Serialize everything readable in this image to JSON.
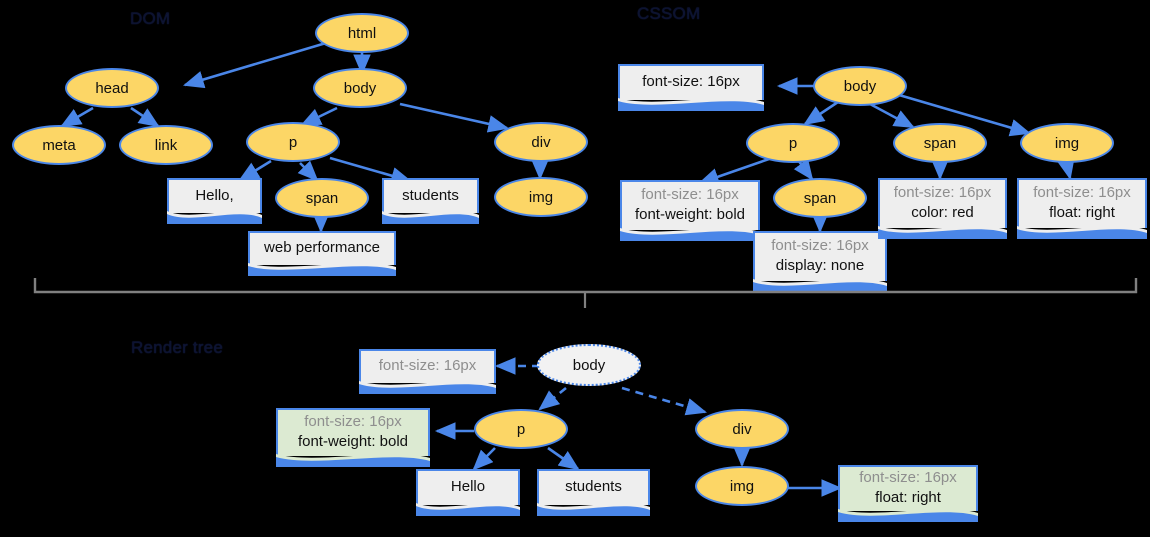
{
  "diagram": {
    "title_dom": "DOM",
    "title_cssom": "CSSOM",
    "title_render": "Render tree",
    "colors": {
      "background": "#000000",
      "node_fill": "#fcd666",
      "node_stroke": "#4a86e8",
      "note_fill": "#eeeeee",
      "note_green_fill": "#dcead2",
      "edge": "#4a86e8",
      "brace": "#808080",
      "muted_text": "#8e8e8e",
      "text": "#111111"
    }
  },
  "dom_tree": {
    "title": "DOM",
    "nodes": [
      {
        "id": "html",
        "label": "html",
        "type": "element"
      },
      {
        "id": "head",
        "label": "head",
        "type": "element"
      },
      {
        "id": "body",
        "label": "body",
        "type": "element"
      },
      {
        "id": "meta",
        "label": "meta",
        "type": "element"
      },
      {
        "id": "link",
        "label": "link",
        "type": "element"
      },
      {
        "id": "p",
        "label": "p",
        "type": "element"
      },
      {
        "id": "div",
        "label": "div",
        "type": "element"
      },
      {
        "id": "span",
        "label": "span",
        "type": "element"
      },
      {
        "id": "img",
        "label": "img",
        "type": "element"
      }
    ],
    "text_nodes": [
      {
        "id": "hello",
        "label": "Hello,"
      },
      {
        "id": "students",
        "label": "students"
      },
      {
        "id": "webperf",
        "label": "web performance"
      }
    ],
    "edges": [
      [
        "html",
        "head"
      ],
      [
        "html",
        "body"
      ],
      [
        "head",
        "meta"
      ],
      [
        "head",
        "link"
      ],
      [
        "body",
        "p"
      ],
      [
        "body",
        "div"
      ],
      [
        "p",
        "hello"
      ],
      [
        "p",
        "span"
      ],
      [
        "p",
        "students"
      ],
      [
        "span",
        "webperf"
      ],
      [
        "div",
        "img"
      ]
    ]
  },
  "cssom_tree": {
    "title": "CSSOM",
    "nodes": [
      {
        "id": "body",
        "label": "body"
      },
      {
        "id": "p",
        "label": "p"
      },
      {
        "id": "span2",
        "label": "span"
      },
      {
        "id": "span3",
        "label": "span"
      },
      {
        "id": "img",
        "label": "img"
      }
    ],
    "rules": [
      {
        "id": "r-body",
        "lines": [
          {
            "text": "font-size: 16px",
            "muted": false
          }
        ]
      },
      {
        "id": "r-p",
        "lines": [
          {
            "text": "font-size: 16px",
            "muted": true
          },
          {
            "text": "font-weight: bold",
            "muted": false
          }
        ]
      },
      {
        "id": "r-span2",
        "lines": [
          {
            "text": "font-size: 16px",
            "muted": true
          },
          {
            "text": "display: none",
            "muted": false
          }
        ]
      },
      {
        "id": "r-span3",
        "lines": [
          {
            "text": "font-size: 16px",
            "muted": true
          },
          {
            "text": "color: red",
            "muted": false
          }
        ]
      },
      {
        "id": "r-img",
        "lines": [
          {
            "text": "font-size: 16px",
            "muted": true
          },
          {
            "text": "float: right",
            "muted": false
          }
        ]
      }
    ],
    "edges": [
      [
        "body",
        "r-body"
      ],
      [
        "body",
        "p"
      ],
      [
        "body",
        "span3"
      ],
      [
        "body",
        "img"
      ],
      [
        "p",
        "r-p"
      ],
      [
        "p",
        "span2"
      ],
      [
        "span2",
        "r-span2"
      ],
      [
        "span3",
        "r-span3"
      ],
      [
        "img",
        "r-img"
      ]
    ]
  },
  "render_tree": {
    "title": "Render tree",
    "nodes": [
      {
        "id": "body",
        "label": "body",
        "style": "dotted"
      },
      {
        "id": "p",
        "label": "p",
        "style": "solid"
      },
      {
        "id": "div",
        "label": "div",
        "style": "solid"
      },
      {
        "id": "img",
        "label": "img",
        "style": "solid"
      }
    ],
    "text_nodes": [
      {
        "id": "hello",
        "label": "Hello"
      },
      {
        "id": "students",
        "label": "students"
      }
    ],
    "rules": [
      {
        "id": "r-body",
        "green": false,
        "lines": [
          {
            "text": "font-size: 16px",
            "muted": true
          }
        ]
      },
      {
        "id": "r-p",
        "green": true,
        "lines": [
          {
            "text": "font-size: 16px",
            "muted": true
          },
          {
            "text": "font-weight: bold",
            "muted": false
          }
        ]
      },
      {
        "id": "r-img",
        "green": true,
        "lines": [
          {
            "text": "font-size: 16px",
            "muted": true
          },
          {
            "text": "float: right",
            "muted": false
          }
        ]
      }
    ],
    "edges": [
      [
        "body",
        "r-body"
      ],
      [
        "body",
        "p"
      ],
      [
        "body",
        "div"
      ],
      [
        "p",
        "r-p"
      ],
      [
        "p",
        "hello"
      ],
      [
        "p",
        "students"
      ],
      [
        "div",
        "img"
      ],
      [
        "img",
        "r-img"
      ]
    ]
  }
}
